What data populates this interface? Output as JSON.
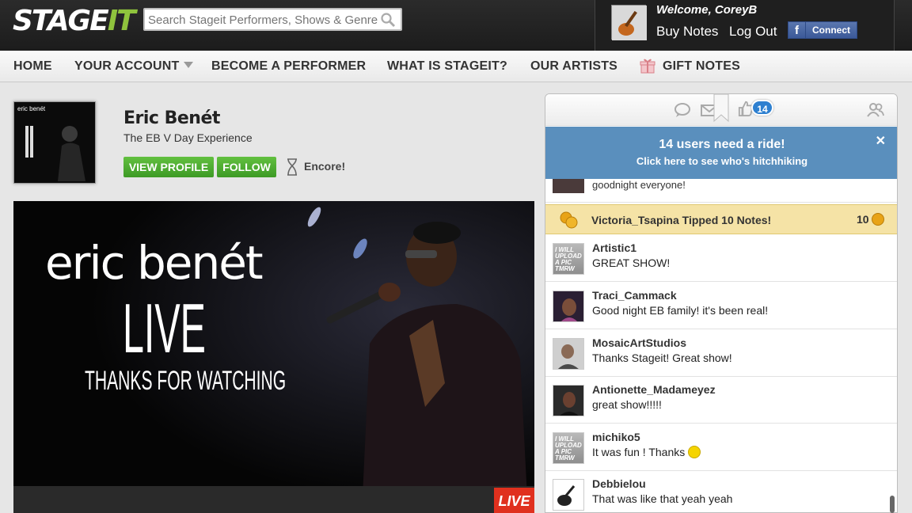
{
  "header": {
    "logo_main": "STAGE",
    "logo_accent": "IT",
    "search_placeholder": "Search Stageit Performers, Shows & Genres",
    "welcome": "Welcome, CoreyB",
    "buy_notes": "Buy Notes",
    "log_out": "Log Out",
    "facebook_connect": "Connect",
    "facebook_f": "f"
  },
  "nav": {
    "items": [
      {
        "label": "HOME"
      },
      {
        "label": "YOUR ACCOUNT"
      },
      {
        "label": "BECOME A PERFORMER"
      },
      {
        "label": "WHAT IS STAGEIT?"
      },
      {
        "label": "OUR ARTISTS"
      },
      {
        "label": "GIFT NOTES"
      }
    ]
  },
  "performer": {
    "name": "Eric Benét",
    "show_title": "The EB V Day Experience",
    "view_profile": "VIEW PROFILE",
    "follow": "FOLLOW",
    "encore": "Encore!",
    "album_label": "eric benét"
  },
  "video": {
    "line1": "eric benét",
    "line2": "LIVE",
    "line3": "THANKS FOR WATCHING",
    "live_badge": "LIVE"
  },
  "chat": {
    "like_count": "14",
    "banner_title": "14 users need a ride!",
    "banner_subtitle": "Click here to see who's hitchhiking",
    "banner_close": "✕",
    "partial_message": "goodnight everyone!",
    "tip": {
      "text": "Victoria_Tsapina Tipped 10 Notes!",
      "amount": "10"
    },
    "messages": [
      {
        "user": "Artistic1",
        "text": "GREAT SHOW!",
        "avatar": "placeholder"
      },
      {
        "user": "Traci_Cammack",
        "text": "Good night EB family! it's been real!",
        "avatar": "photo"
      },
      {
        "user": "MosaicArtStudios",
        "text": "Thanks Stageit! Great show!",
        "avatar": "photo"
      },
      {
        "user": "Antionette_Madameyez",
        "text": "great show!!!!!",
        "avatar": "photo"
      },
      {
        "user": "michiko5",
        "text": "It was fun ! Thanks",
        "avatar": "placeholder"
      },
      {
        "user": "Debbielou",
        "text": "That was like that yeah yeah",
        "avatar": "guitar"
      }
    ],
    "placeholder_avatar_text": "I WILL UPLOAD A PIC TMRW"
  },
  "colors": {
    "brand_green": "#8fc33d",
    "button_green": "#4caf2f",
    "banner_blue": "#5a8fbd",
    "tip_yellow": "#f5e3a6",
    "live_red": "#e0301e",
    "facebook_blue": "#3b5998"
  }
}
